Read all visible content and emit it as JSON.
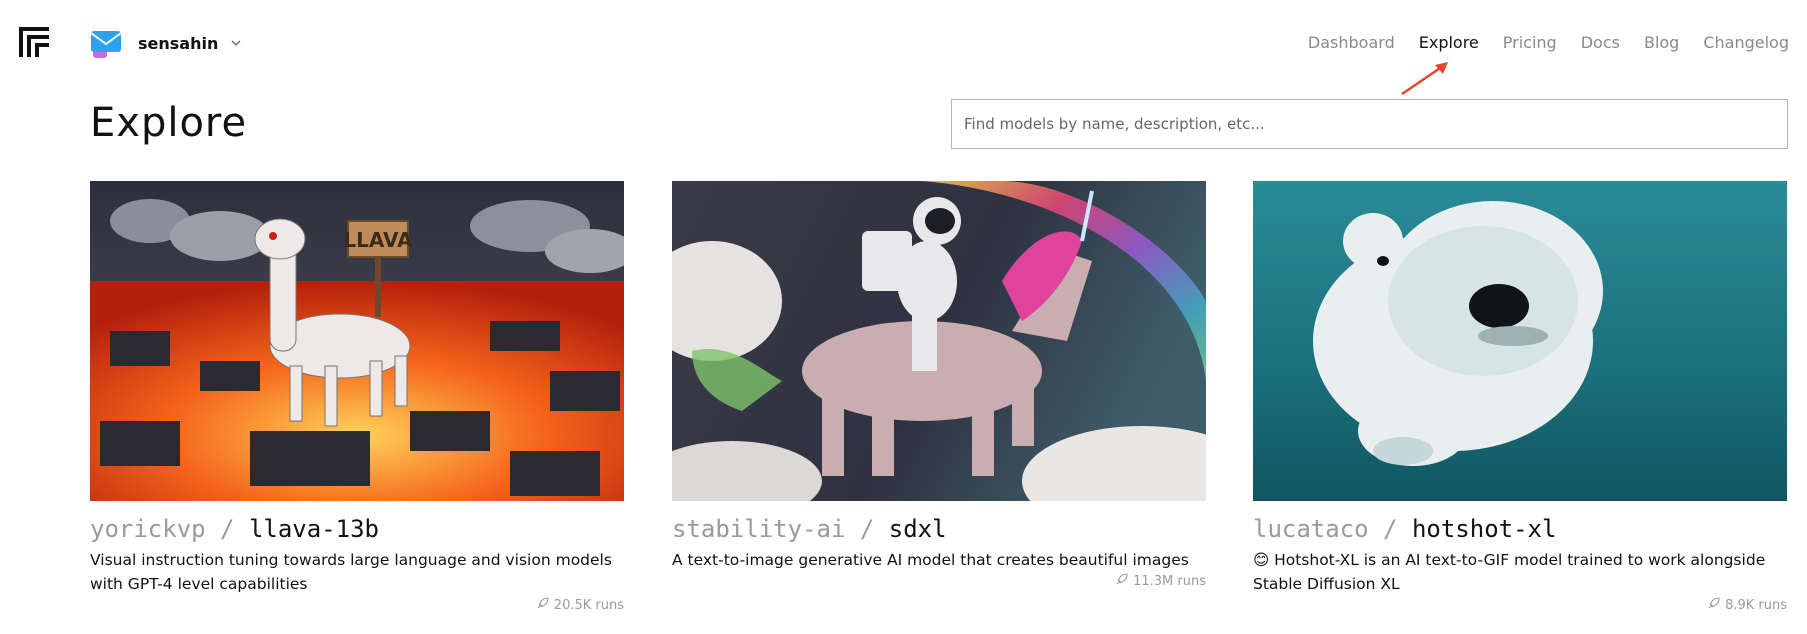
{
  "header": {
    "username": "sensahin",
    "nav": [
      {
        "label": "Dashboard",
        "active": false
      },
      {
        "label": "Explore",
        "active": true
      },
      {
        "label": "Pricing",
        "active": false
      },
      {
        "label": "Docs",
        "active": false
      },
      {
        "label": "Blog",
        "active": false
      },
      {
        "label": "Changelog",
        "active": false
      }
    ]
  },
  "main": {
    "title": "Explore",
    "search_placeholder": "Find models by name, description, etc..."
  },
  "cards": [
    {
      "owner": "yorickvp",
      "separator": "/",
      "model": "llava-13b",
      "description": "Visual instruction tuning towards large language and vision models with GPT-4 level capabilities",
      "runs": "20.5K runs"
    },
    {
      "owner": "stability-ai",
      "separator": "/",
      "model": "sdxl",
      "description": "A text-to-image generative AI model that creates beautiful images",
      "runs": "11.3M runs"
    },
    {
      "owner": "lucataco",
      "separator": "/",
      "model": "hotshot-xl",
      "description": "😊 Hotshot-XL is an AI text-to-GIF model trained to work alongside Stable Diffusion XL",
      "runs": "8.9K runs"
    }
  ],
  "colors": {
    "accent_arrow": "#e8452c",
    "nav_inactive": "#8a8a8a",
    "text": "#111111"
  }
}
